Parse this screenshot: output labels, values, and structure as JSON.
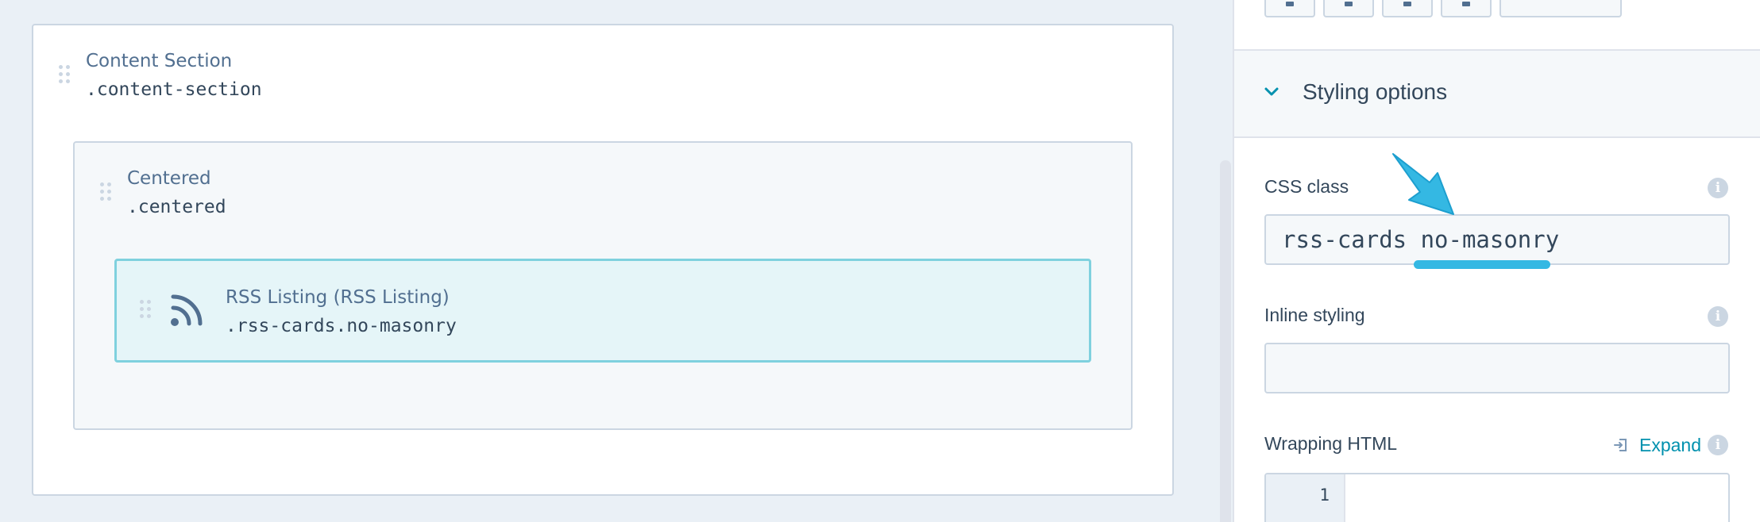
{
  "canvas": {
    "content_section": {
      "title": "Content Section",
      "class_name": ".content-section"
    },
    "centered": {
      "title": "Centered",
      "class_name": ".centered"
    },
    "rss_module": {
      "title": "RSS Listing (RSS Listing)",
      "class_name": ".rss-cards.no-masonry",
      "icon": "rss-icon"
    }
  },
  "panel": {
    "styling_options": {
      "title": "Styling options",
      "expanded": true
    },
    "css_class": {
      "label": "CSS class",
      "value": "rss-cards no-masonry"
    },
    "inline_styling": {
      "label": "Inline styling",
      "value": ""
    },
    "wrapping_html": {
      "label": "Wrapping HTML",
      "expand_label": "Expand",
      "line_number": "1"
    }
  },
  "colors": {
    "accent": "#0091ae",
    "module_border": "#7fd1de",
    "module_fill": "#e5f5f8",
    "annotation": "#34b8e3"
  }
}
